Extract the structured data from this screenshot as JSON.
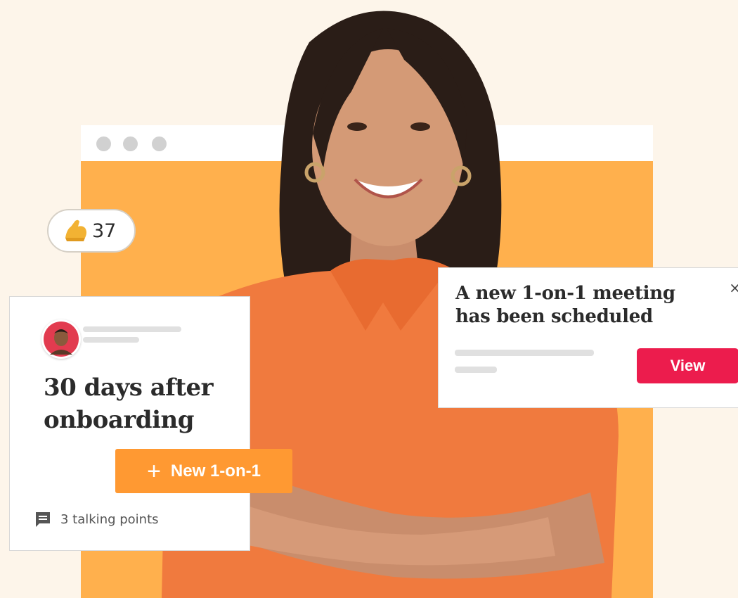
{
  "colors": {
    "background": "#fdf5ea",
    "browser_fill": "#ffb04d",
    "accent_orange": "#ff9932",
    "accent_red": "#ec1c4d",
    "shirt": "#f07a3e"
  },
  "reaction": {
    "icon": "flexed-biceps-icon",
    "count": "37"
  },
  "card": {
    "title": "30 days after onboarding",
    "talking_points": "3 talking points",
    "talking_icon": "comment-icon"
  },
  "new_button": {
    "plus": "+",
    "label": "New 1-on-1"
  },
  "notification": {
    "title": "A new 1-on-1 meeting has been scheduled",
    "close": "×",
    "view_label": "View"
  }
}
